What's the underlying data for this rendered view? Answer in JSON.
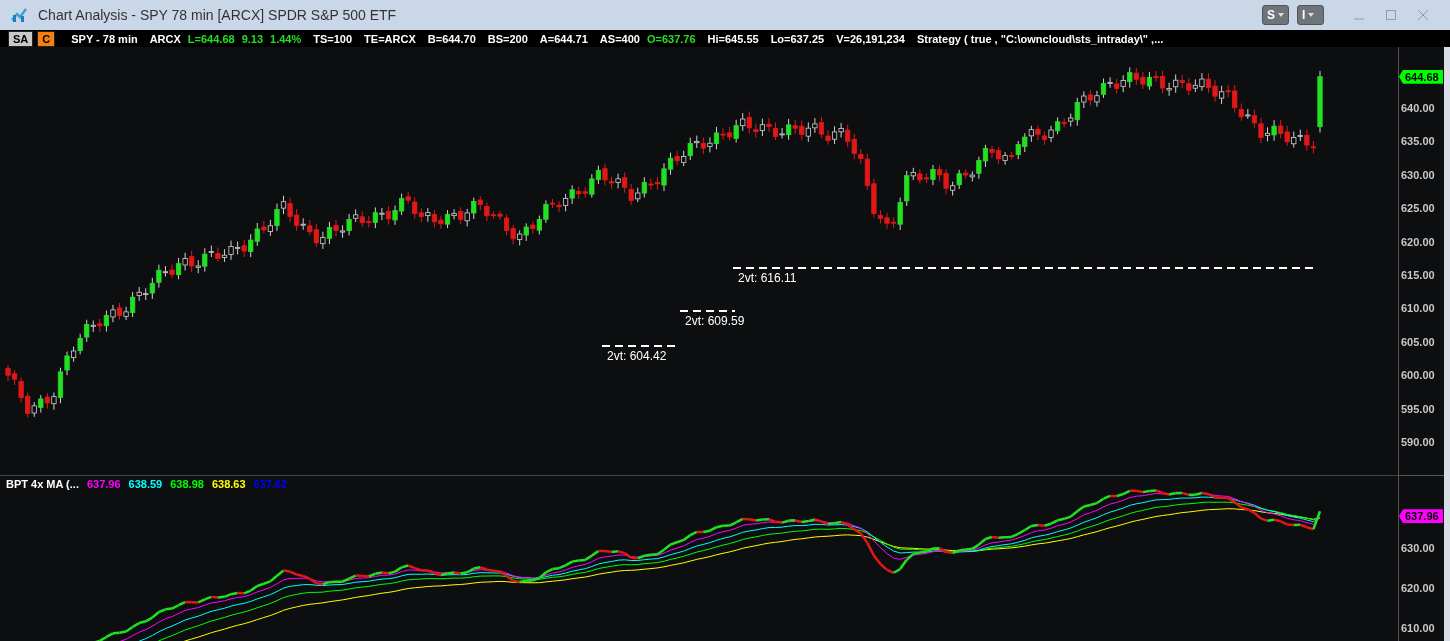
{
  "window": {
    "title": "Chart Analysis - SPY 78 min [ARCX] SPDR S&P 500 ETF"
  },
  "title_buttons": [
    {
      "label": "S"
    },
    {
      "label": "I"
    }
  ],
  "symbol_bar": {
    "tags": [
      {
        "label": "SA",
        "kind": "study"
      },
      {
        "label": "C",
        "kind": "chart"
      }
    ],
    "fields": [
      {
        "text": "SPY - 78 min",
        "kind": "plain"
      },
      {
        "text": "ARCX",
        "kind": "plain"
      },
      {
        "text": "L=644.68",
        "kind": "up"
      },
      {
        "text": "9.13",
        "kind": "up"
      },
      {
        "text": "1.44%",
        "kind": "up"
      },
      {
        "text": "TS=100",
        "kind": "plain"
      },
      {
        "text": "TE=ARCX",
        "kind": "plain"
      },
      {
        "text": "B=644.70",
        "kind": "plain"
      },
      {
        "text": "BS=200",
        "kind": "plain"
      },
      {
        "text": "A=644.71",
        "kind": "plain"
      },
      {
        "text": "AS=400",
        "kind": "plain"
      },
      {
        "text": "O=637.76",
        "kind": "up"
      },
      {
        "text": "Hi=645.55",
        "kind": "plain"
      },
      {
        "text": "Lo=637.25",
        "kind": "plain"
      },
      {
        "text": "V=26,191,234",
        "kind": "plain"
      },
      {
        "text": "Strategy ( true , \"C:\\owncloud\\sts_intraday\\\" ,...",
        "kind": "plain"
      }
    ]
  },
  "price_panel": {
    "axis_labels": [
      "640.00",
      "635.00",
      "630.00",
      "625.00",
      "620.00",
      "615.00",
      "610.00",
      "605.00",
      "600.00",
      "595.00",
      "590.00"
    ],
    "last_price": "644.68",
    "levels": [
      {
        "label": "2vt: 616.11"
      },
      {
        "label": "2vt: 609.59"
      },
      {
        "label": "2vt: 604.42"
      }
    ]
  },
  "indicator_panel": {
    "name": "BPT 4x MA (...",
    "values": [
      {
        "text": "637.96",
        "color": "#ff00ff"
      },
      {
        "text": "638.59",
        "color": "#00ffff"
      },
      {
        "text": "638.98",
        "color": "#00ff00"
      },
      {
        "text": "638.63",
        "color": "#ffff00"
      },
      {
        "text": "637.62",
        "color": "#0000ff"
      }
    ],
    "axis_labels": [
      "630.00",
      "620.00",
      "610.00"
    ],
    "last_value": "637.96"
  }
}
